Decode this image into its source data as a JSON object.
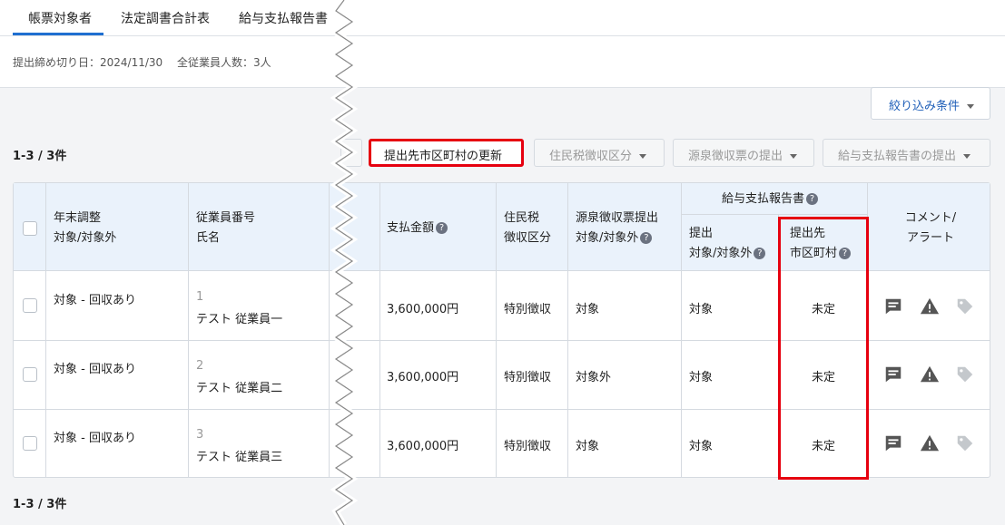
{
  "tabs": [
    "帳票対象者",
    "法定調書合計表",
    "給与支払報告書"
  ],
  "meta": {
    "deadline": "提出締め切り日：2024/11/30",
    "employees": "全従業員人数：3人"
  },
  "filter_label": "絞り込み条件",
  "count_label": "1-3 / 3件",
  "toolbar": {
    "update_municipality": "提出先市区町村の更新",
    "resident_tax": "住民税徴収区分",
    "withholding": "源泉徴収票の提出",
    "salary_report": "給与支払報告書の提出"
  },
  "headers": {
    "year_end_1": "年末調整",
    "year_end_2": "対象/対象外",
    "emp_1": "従業員番号",
    "emp_2": "氏名",
    "payment": "支払金額",
    "restax_1": "住民税",
    "restax_2": "徴収区分",
    "wh_1": "源泉徴収票提出",
    "wh_2": "対象/対象外",
    "salary_group": "給与支払報告書",
    "submit_1": "提出",
    "submit_2": "対象/対象外",
    "dest_1": "提出先",
    "dest_2": "市区町村",
    "comment_1": "コメント/",
    "comment_2": "アラート",
    "help": "?"
  },
  "rows": [
    {
      "year_end": "対象 - 回収あり",
      "number": "1",
      "name": "テスト 従業員一",
      "payment": "3,600,000円",
      "tax_class": "特別徴収",
      "withholding": "対象",
      "submit": "対象",
      "destination": "未定"
    },
    {
      "year_end": "対象 - 回収あり",
      "number": "2",
      "name": "テスト 従業員二",
      "payment": "3,600,000円",
      "tax_class": "特別徴収",
      "withholding": "対象外",
      "submit": "対象",
      "destination": "未定"
    },
    {
      "year_end": "対象 - 回収あり",
      "number": "3",
      "name": "テスト 従業員三",
      "payment": "3,600,000円",
      "tax_class": "特別徴収",
      "withholding": "対象",
      "submit": "対象",
      "destination": "未定"
    }
  ],
  "icons": [
    "comment-icon",
    "warning-icon",
    "tag-icon"
  ],
  "colors": {
    "accent": "#1f6fd0",
    "highlight": "#e6000f",
    "header_bg": "#eaf2fb"
  }
}
